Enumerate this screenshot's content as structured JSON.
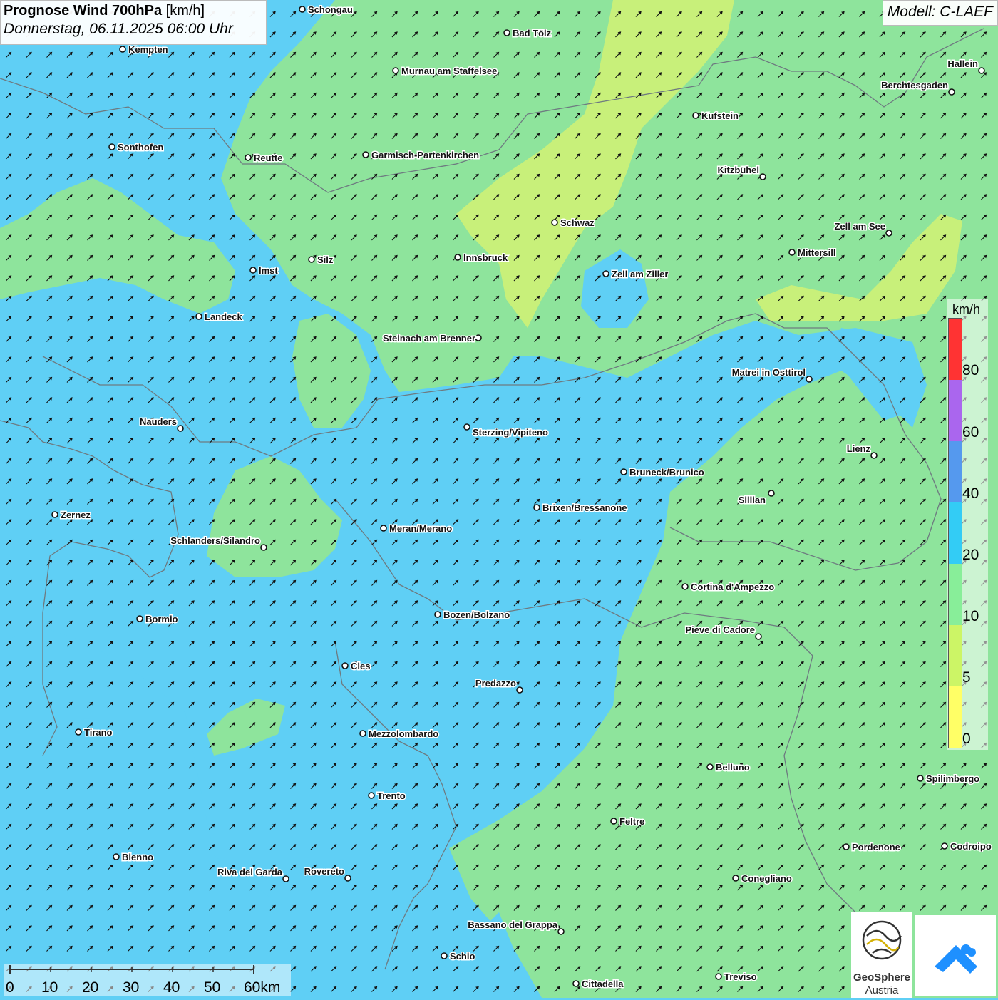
{
  "header": {
    "title_bold": "Prognose Wind 700hPa",
    "title_unit": "[km/h]",
    "subtitle": "Donnerstag, 06.11.2025 06:00 Uhr",
    "model": "Modell: C-LAEF"
  },
  "legend": {
    "unit": "km/h",
    "ticks": [
      "80",
      "60",
      "40",
      "20",
      "10",
      "5",
      "0"
    ],
    "colors_top_to_bottom": [
      "#ff3333",
      "#aa66ee",
      "#5599ee",
      "#33ccf5",
      "#88ee99",
      "#ccf566",
      "#ffff66"
    ]
  },
  "scale_bar": {
    "labels": [
      "0",
      "10",
      "20",
      "30",
      "40",
      "50",
      "60km"
    ]
  },
  "logo": {
    "line1": "GeoSphere",
    "line2": "Austria"
  },
  "wind_field": {
    "direction_deg_to": 45,
    "dominant_class_km_h": "10-20"
  },
  "cities": [
    {
      "name": "Schongau"
    },
    {
      "name": "Kempten"
    },
    {
      "name": "Bad Tölz"
    },
    {
      "name": "Murnau am Staffelsee"
    },
    {
      "name": "Hallein"
    },
    {
      "name": "Berchtesgaden"
    },
    {
      "name": "Kufstein"
    },
    {
      "name": "Sonthofen"
    },
    {
      "name": "Reutte"
    },
    {
      "name": "Garmisch-Partenkirchen"
    },
    {
      "name": "Kitzbühel"
    },
    {
      "name": "Schwaz"
    },
    {
      "name": "Zell am See"
    },
    {
      "name": "Mittersill"
    },
    {
      "name": "Imst"
    },
    {
      "name": "Silz"
    },
    {
      "name": "Innsbruck"
    },
    {
      "name": "Zell am Ziller"
    },
    {
      "name": "Landeck"
    },
    {
      "name": "Steinach am Brenner"
    },
    {
      "name": "Matrei in Osttirol"
    },
    {
      "name": "Nauders"
    },
    {
      "name": "Sterzing/Vipiteno"
    },
    {
      "name": "Lienz"
    },
    {
      "name": "Bruneck/Brunico"
    },
    {
      "name": "Sillian"
    },
    {
      "name": "Brixen/Bressanone"
    },
    {
      "name": "Zernez"
    },
    {
      "name": "Meran/Merano"
    },
    {
      "name": "Schlanders/Silandro"
    },
    {
      "name": "Cortina d'Ampezzo"
    },
    {
      "name": "Bozen/Bolzano"
    },
    {
      "name": "Bormio"
    },
    {
      "name": "Pieve di Cadore"
    },
    {
      "name": "Cles"
    },
    {
      "name": "Predazzo"
    },
    {
      "name": "Tirano"
    },
    {
      "name": "Mezzolombardo"
    },
    {
      "name": "Belluno"
    },
    {
      "name": "Spilimbergo"
    },
    {
      "name": "Trento"
    },
    {
      "name": "Feltre"
    },
    {
      "name": "Pordenone"
    },
    {
      "name": "Codroipo"
    },
    {
      "name": "Bienno"
    },
    {
      "name": "Riva del Garda"
    },
    {
      "name": "Rovereto"
    },
    {
      "name": "Conegliano"
    },
    {
      "name": "Bassano del Grappa"
    },
    {
      "name": "Schio"
    },
    {
      "name": "Treviso"
    },
    {
      "name": "Cittadella"
    }
  ]
}
